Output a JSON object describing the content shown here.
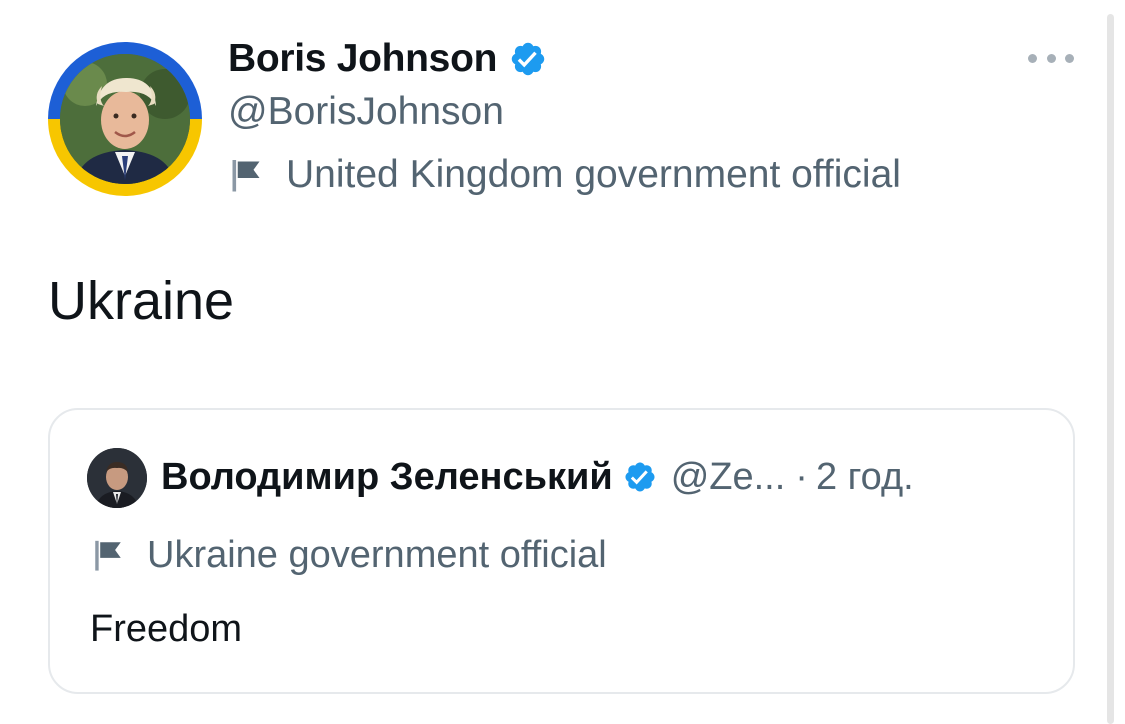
{
  "tweet": {
    "author": {
      "name": "Boris Johnson",
      "handle": "@BorisJohnson",
      "verified": true,
      "label": "United Kingdom government official"
    },
    "text": "Ukraine",
    "more_icon": "more-horizontal-icon"
  },
  "quoted_tweet": {
    "author": {
      "name": "Володимир Зеленський",
      "handle": "@Ze...",
      "verified": true,
      "label": "Ukraine government official"
    },
    "separator": "·",
    "time": "2 год.",
    "text": "Freedom"
  },
  "colors": {
    "verified_blue": "#1d9bf0",
    "secondary_text": "#536471",
    "primary_text": "#0f1419",
    "ring_blue": "#1d5fd6",
    "ring_yellow": "#f7c600"
  }
}
